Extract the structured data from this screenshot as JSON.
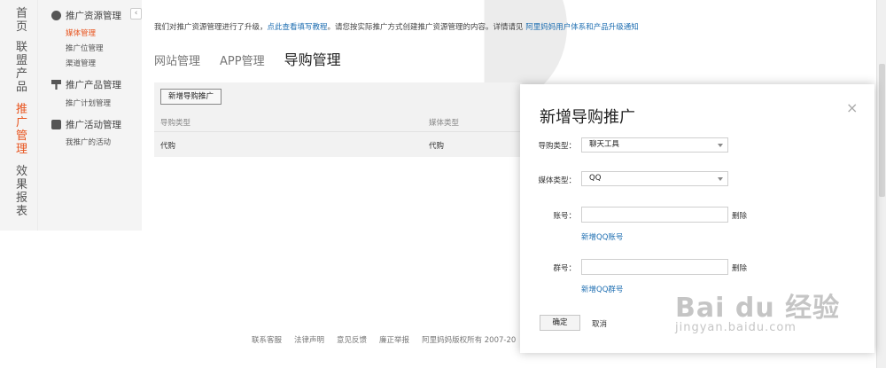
{
  "vertical_nav": [
    {
      "label": "首页",
      "active": false
    },
    {
      "label": "联盟产品",
      "active": false
    },
    {
      "label": "推广管理",
      "active": true
    },
    {
      "label": "效果报表",
      "active": false
    }
  ],
  "sidebar": {
    "collapse_icon": "chevron-left-icon",
    "groups": [
      {
        "title": "推广资源管理",
        "icon": "globe-icon",
        "items": [
          "媒体管理",
          "推广位管理",
          "渠道管理"
        ],
        "active_item": "媒体管理"
      },
      {
        "title": "推广产品管理",
        "icon": "pin-icon",
        "items": [
          "推广计划管理"
        ]
      },
      {
        "title": "推广活动管理",
        "icon": "gear-icon",
        "items": [
          "我推广的活动"
        ]
      }
    ]
  },
  "notice": {
    "text1": "我们对推广资源管理进行了升级，",
    "link1": "点此查看填写教程",
    "text2": "。请您按实际推广方式创建推广资源管理的内容。详情请见",
    "link2": "阿里妈妈用户体系和产品升级通知"
  },
  "tabs": [
    {
      "label": "网站管理",
      "active": false
    },
    {
      "label": "APP管理",
      "active": false
    },
    {
      "label": "导购管理",
      "active": true
    }
  ],
  "table": {
    "new_button": "新增导购推广",
    "headers": [
      "导购类型",
      "媒体类型"
    ],
    "rows": [
      [
        "代购",
        "代购"
      ]
    ]
  },
  "footer": {
    "links": [
      "联系客服",
      "法律声明",
      "意见反馈",
      "廉正举报"
    ],
    "copyright": "阿里妈妈版权所有 2007-20"
  },
  "dialog": {
    "title": "新增导购推广",
    "close": "×",
    "fields": {
      "guide_type_label": "导购类型：",
      "guide_type_value": "聊天工具",
      "media_type_label": "媒体类型：",
      "media_type_value": "QQ",
      "account_label": "账号：",
      "account_delete": "删除",
      "account_add": "新增QQ账号",
      "group_label": "群号：",
      "group_delete": "删除",
      "group_add": "新增QQ群号"
    },
    "ok": "确定",
    "cancel": "取消"
  },
  "watermark": {
    "big": "Bai du 经验",
    "small": "jingyan.baidu.com"
  }
}
